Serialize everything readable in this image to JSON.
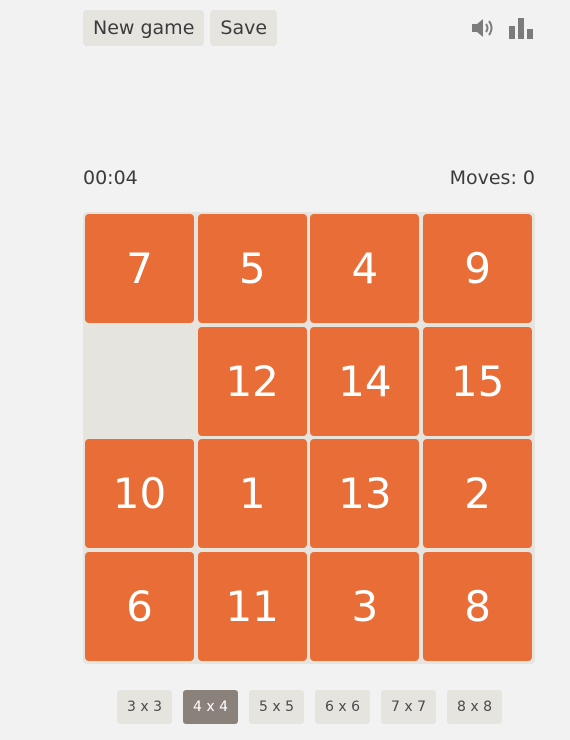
{
  "toolbar": {
    "new_game_label": "New game",
    "save_label": "Save",
    "icons": [
      "sound-icon",
      "stats-icon"
    ]
  },
  "status": {
    "timer": "00:04",
    "moves": "Moves: 0"
  },
  "board": {
    "size": 4,
    "rows": [
      [
        "7",
        "5",
        "4",
        "9"
      ],
      [
        "",
        "12",
        "14",
        "15"
      ],
      [
        "10",
        "1",
        "13",
        "2"
      ],
      [
        "6",
        "11",
        "3",
        "8"
      ]
    ]
  },
  "size_options": [
    "3 x 3",
    "4 x 4",
    "5 x 5",
    "6 x 6",
    "7 x 7",
    "8 x 8"
  ],
  "selected_size": "4 x 4",
  "colors": {
    "tile": "#e96d37",
    "board": "#e6e4df",
    "background": "#f2f2f2",
    "active_size": "#8a817a"
  }
}
